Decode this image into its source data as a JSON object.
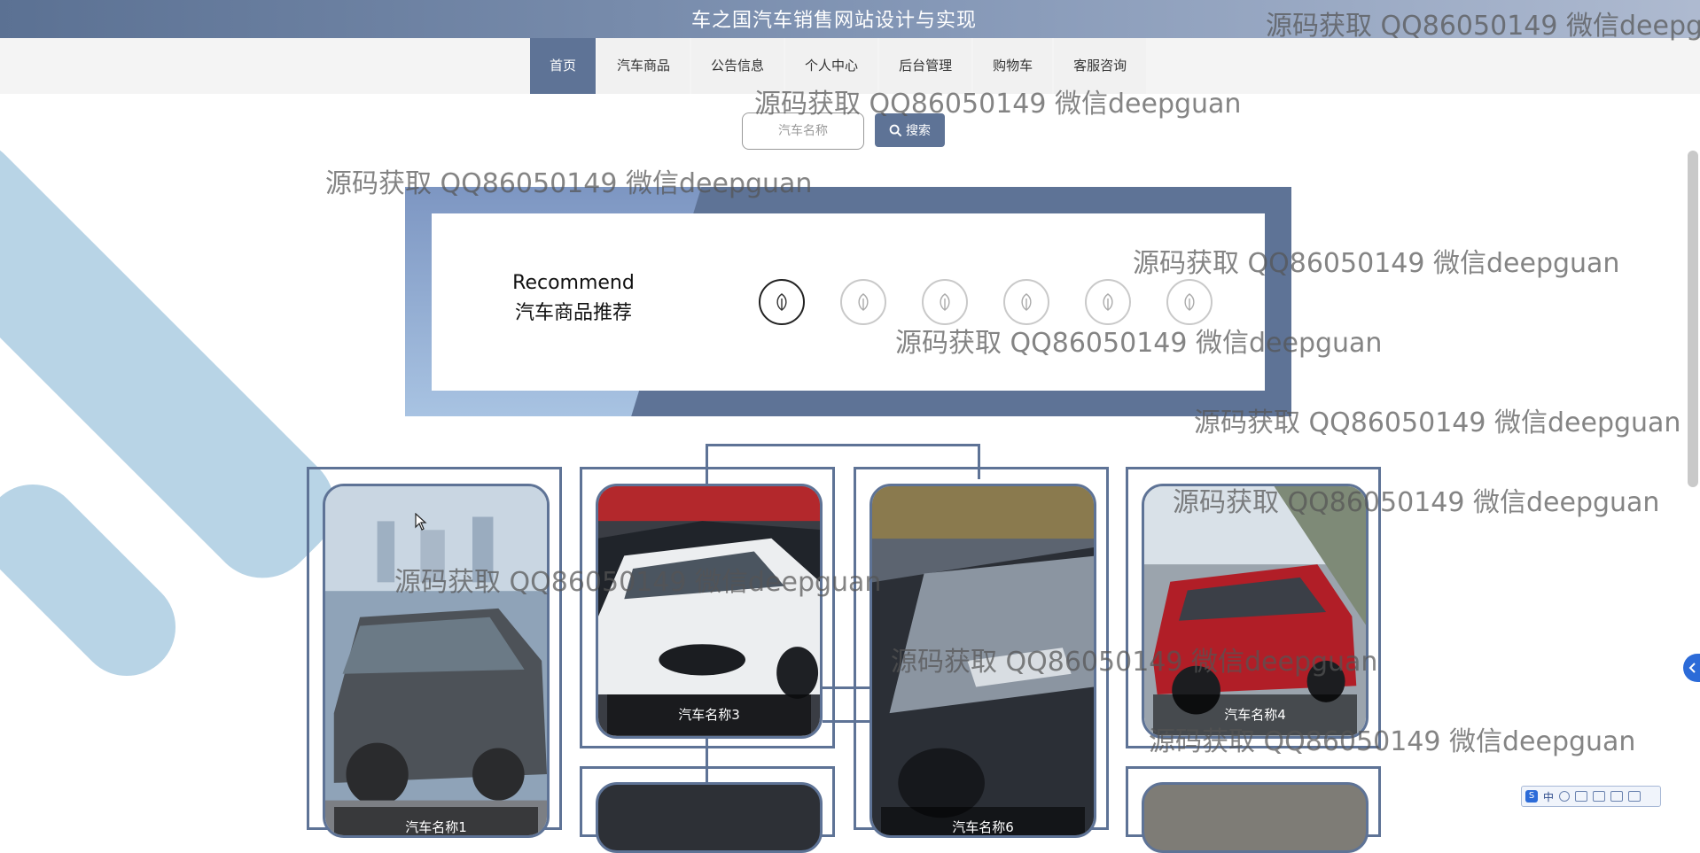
{
  "header": {
    "title": "车之国汽车销售网站设计与实现"
  },
  "nav": {
    "items": [
      {
        "label": "首页",
        "active": true
      },
      {
        "label": "汽车商品",
        "active": false
      },
      {
        "label": "公告信息",
        "active": false
      },
      {
        "label": "个人中心",
        "active": false
      },
      {
        "label": "后台管理",
        "active": false
      },
      {
        "label": "购物车",
        "active": false
      },
      {
        "label": "客服咨询",
        "active": false
      }
    ]
  },
  "search": {
    "placeholder": "汽车名称",
    "button_label": "搜索",
    "button_icon": "search-icon"
  },
  "recommend": {
    "title_en": "Recommend",
    "title_cn": "汽车商品推荐",
    "carousel_count": 6,
    "active_index": 0
  },
  "products": {
    "cards": [
      {
        "caption": "汽车名称1",
        "icon": "car-photo"
      },
      {
        "caption": "汽车名称3",
        "icon": "car-photo"
      },
      {
        "caption": "汽车名称6",
        "icon": "car-photo"
      },
      {
        "caption": "汽车名称4",
        "icon": "car-photo"
      }
    ]
  },
  "watermark": {
    "text": "源码获取 QQ86050149 微信deepguan",
    "text_partial": "源码获取 QQ86050149 微信deepgu"
  },
  "ime": {
    "label": "中"
  },
  "colors": {
    "accent": "#5e7396",
    "header_gradient_start": "#5b7193",
    "background_stripe": "#b8d4e6"
  }
}
